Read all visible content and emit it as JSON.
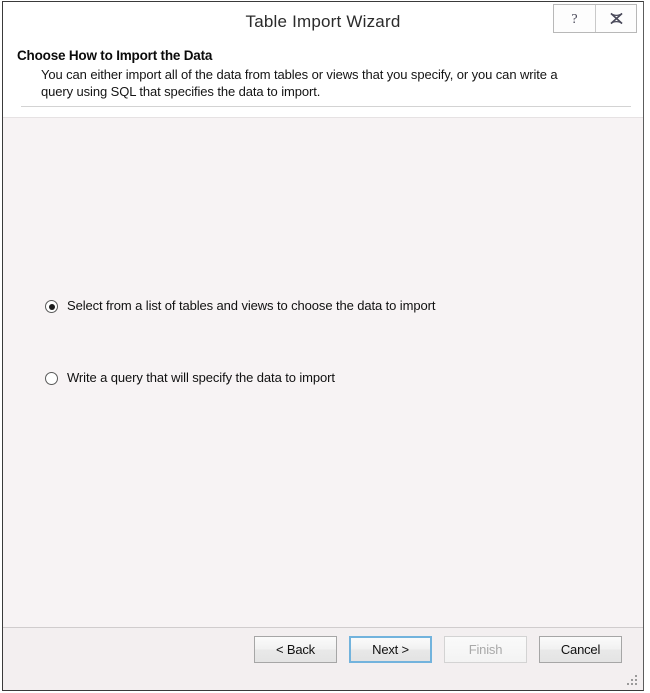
{
  "window": {
    "title": "Table Import Wizard",
    "sys_buttons": [
      {
        "name": "help",
        "icon": "question-mark-icon",
        "glyph": "?"
      },
      {
        "name": "close",
        "icon": "close-icon",
        "glyph": "✖"
      }
    ]
  },
  "header": {
    "title": "Choose How to Import the Data",
    "description": "You can either import all of the data from tables or views that you specify, or you can write a query using SQL that specifies the data to import."
  },
  "options": [
    {
      "id": "select-from-list",
      "label": "Select from a list of tables and views to choose the data to import",
      "checked": true
    },
    {
      "id": "write-query",
      "label": "Write a query that will specify the data to import",
      "checked": false
    }
  ],
  "footer": {
    "buttons": [
      {
        "id": "back",
        "label": "< Back",
        "state": "normal"
      },
      {
        "id": "next",
        "label": "Next >",
        "state": "default"
      },
      {
        "id": "finish",
        "label": "Finish",
        "state": "disabled"
      },
      {
        "id": "cancel",
        "label": "Cancel",
        "state": "normal"
      }
    ],
    "resize_grip": "resize-grip-icon"
  },
  "colors": {
    "body_background": "#f7f3f4",
    "titlebar_background": "#ffffff",
    "focus_border": "#72b3dd",
    "disabled_text": "#a9a9a9",
    "text": "#111111"
  }
}
